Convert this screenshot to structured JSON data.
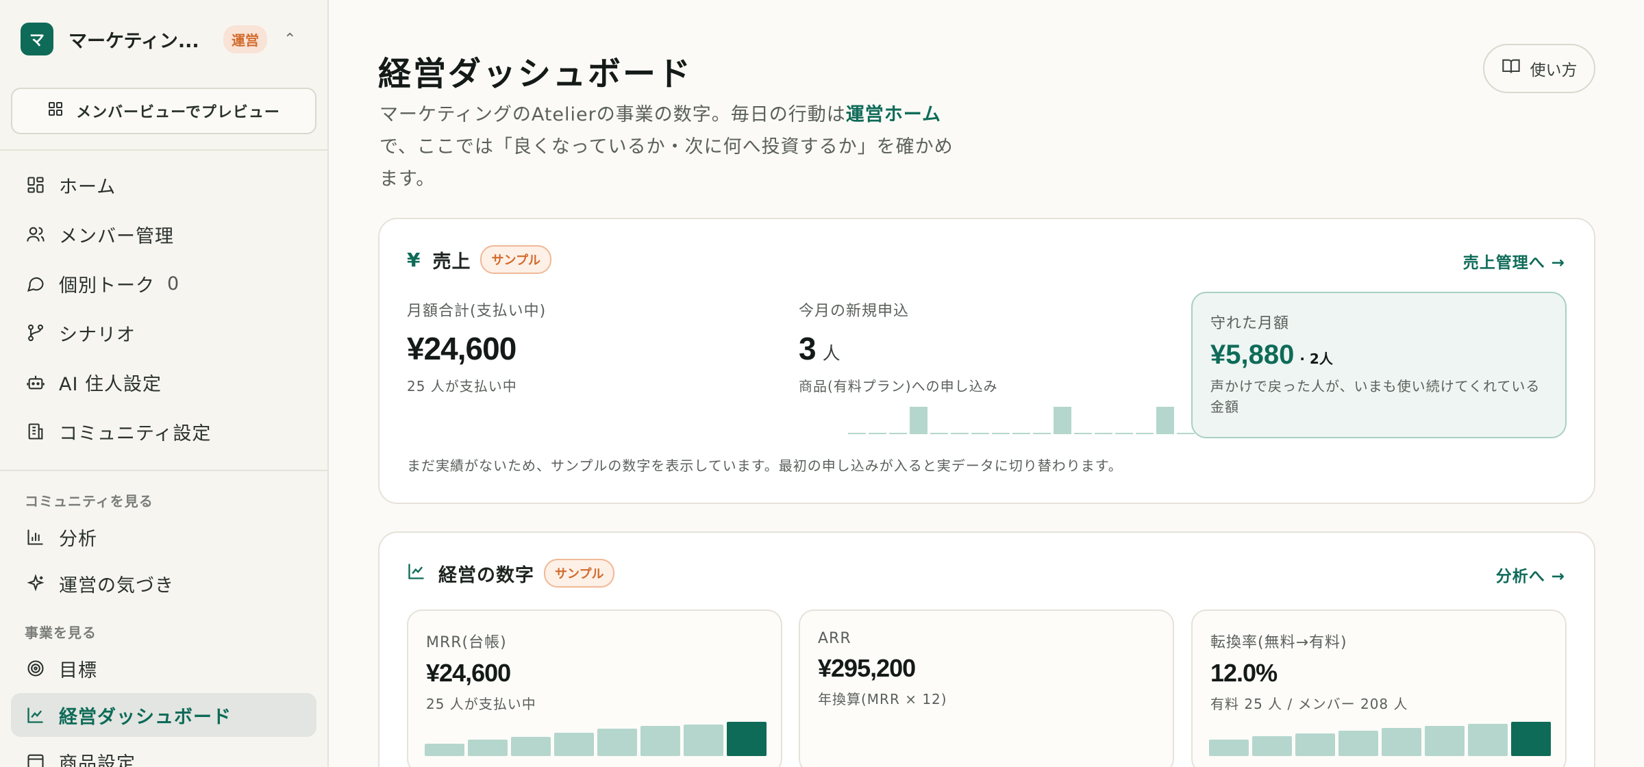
{
  "workspace": {
    "logo_letter": "マ",
    "name": "マーケティン...",
    "role_badge": "運営"
  },
  "sidebar": {
    "preview_button": "メンバービューでプレビュー",
    "main_nav": [
      {
        "label": "ホーム",
        "icon": "grid-icon"
      },
      {
        "label": "メンバー管理",
        "icon": "users-icon"
      },
      {
        "label": "個別トーク",
        "icon": "chat-icon",
        "count": "0"
      },
      {
        "label": "シナリオ",
        "icon": "branch-icon"
      },
      {
        "label": "AI 住人設定",
        "icon": "robot-icon"
      },
      {
        "label": "コミュニティ設定",
        "icon": "building-icon"
      }
    ],
    "section_community": "コミュニティを見る",
    "community_nav": [
      {
        "label": "分析",
        "icon": "bar-chart-icon"
      },
      {
        "label": "運営の気づき",
        "icon": "sparkle-icon"
      }
    ],
    "section_business": "事業を見る",
    "business_nav": [
      {
        "label": "目標",
        "icon": "target-icon"
      },
      {
        "label": "経営ダッシュボード",
        "icon": "trend-icon",
        "active": true
      },
      {
        "label": "商品設定",
        "icon": "product-icon"
      }
    ]
  },
  "page": {
    "title": "経営ダッシュボード",
    "intro_prefix": "マーケティングのAtelierの事業の数字。毎日の行動は",
    "intro_link": "運営ホーム",
    "intro_suffix": "で、ここでは「良くなっているか・次に何へ投資するか」を確かめます。",
    "help_button": "使い方"
  },
  "sales_card": {
    "icon": "¥",
    "title": "売上",
    "badge": "サンプル",
    "link": "売上管理へ →",
    "monthly_total": {
      "label": "月額合計(支払い中)",
      "value": "¥24,600",
      "sub": "25 人が支払い中"
    },
    "new_signups": {
      "label": "今月の新規申込",
      "value": "3",
      "unit": "人",
      "sub": "商品(有料プラン)への申し込み",
      "daily": [
        0,
        0,
        0,
        1,
        0,
        0,
        0,
        0,
        0,
        0,
        1,
        0,
        0,
        0,
        0,
        1,
        0,
        0
      ]
    },
    "protected": {
      "label": "守れた月額",
      "value": "¥5,880",
      "people": "· 2人",
      "desc": "声かけで戻った人が、いまも使い続けてくれている金額"
    },
    "note": "まだ実績がないため、サンプルの数字を表示しています。最初の申し込みが入ると実データに切り替わります。"
  },
  "kpi_card": {
    "title": "経営の数字",
    "badge": "サンプル",
    "link": "分析へ →",
    "metrics": [
      {
        "label": "MRR(台帳)",
        "value": "¥24,600",
        "sub": "25 人が支払い中",
        "trend": [
          0.36,
          0.48,
          0.56,
          0.68,
          0.8,
          0.88,
          0.92,
          1.0
        ]
      },
      {
        "label": "ARR",
        "value": "¥295,200",
        "sub": "年換算(MRR × 12)"
      },
      {
        "label": "転換率(無料→有料)",
        "value": "12.0%",
        "sub": "有料 25 人 / メンバー 208 人",
        "trend": [
          0.48,
          0.58,
          0.66,
          0.74,
          0.82,
          0.88,
          0.94,
          1.0
        ]
      }
    ]
  }
}
